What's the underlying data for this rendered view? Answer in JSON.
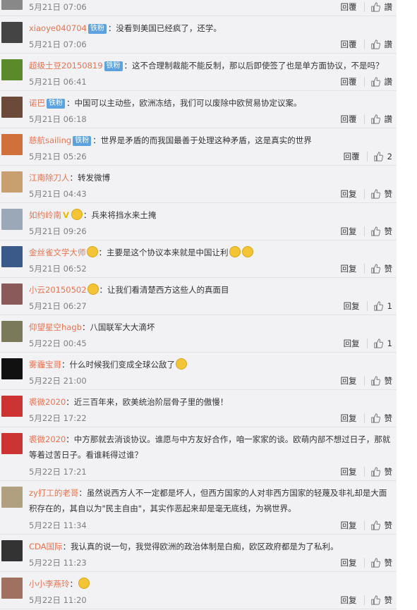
{
  "labels": {
    "reply": "回復",
    "like": "赞"
  },
  "comments": [
    {
      "id": "c0",
      "user": "",
      "badge": "",
      "text": "",
      "date": "5月21日 07:06",
      "reply": "回覆",
      "like": "讚",
      "avatar": "#888888"
    },
    {
      "id": "c1",
      "user": "xiaoye040704",
      "badge": "铁粉",
      "text": "：没看到美国已经疯了，还学。",
      "date": "5月21日 07:06",
      "reply": "回覆",
      "like": "讚",
      "avatar": "#444444"
    },
    {
      "id": "c2",
      "user": "超级土豆20150819",
      "badge": "铁粉",
      "text": "：这不合理制裁能不能反制，那以后即使签了也是单方面协议，不是吗？",
      "date": "5月21日 06:41",
      "reply": "回覆",
      "like": "讚",
      "avatar": "#5a8a2a"
    },
    {
      "id": "c3",
      "user": "诺巴",
      "badge": "铁粉",
      "text": "：中国可以主动些，欧洲冻结，我们可以废除中欧贸易协定议案。",
      "date": "5月21日 06:18",
      "reply": "回覆",
      "like": "讚",
      "avatar": "#6b4a3a"
    },
    {
      "id": "c4",
      "user": "慈航sailing",
      "badge": "铁粉",
      "text": "：世界是矛盾的而我国最善于处理这种矛盾，这是真实的世界",
      "date": "5月21日 05:26",
      "reply": "回覆",
      "like": "2",
      "avatar": "#d0703a"
    },
    {
      "id": "c5",
      "user": "江南除刀人",
      "badge": "",
      "text": "：转发微博",
      "date": "5月21日 04:43",
      "reply": "回复",
      "like": "赞",
      "avatar": "#c8a070"
    },
    {
      "id": "c6",
      "user": "如约岭南",
      "badge": "",
      "vip": "V",
      "emoji": true,
      "text": "：兵来将挡水来土掩",
      "date": "5月21日 09:26",
      "reply": "回复",
      "like": "赞",
      "avatar": "#9aa8b8"
    },
    {
      "id": "c7",
      "user": "金丝雀文学大师",
      "badge": "",
      "emoji": true,
      "text": "：主要是这个协议本来就是中国让利",
      "tailEmoji": 2,
      "date": "5月21日 06:52",
      "reply": "回复",
      "like": "赞",
      "avatar": "#3a5a8a"
    },
    {
      "id": "c8",
      "user": "小云20150502",
      "badge": "",
      "emoji": true,
      "text": "：让我们看清楚西方这些人的真面目",
      "date": "5月21日 06:27",
      "reply": "回复",
      "like": "1",
      "avatar": "#8a5a5a"
    },
    {
      "id": "c9",
      "user": "仰望星空hagb",
      "badge": "",
      "text": "：八国联军大大滴坏",
      "date": "5月22日 00:45",
      "reply": "回复",
      "like": "1",
      "avatar": "#7a7a5a"
    },
    {
      "id": "c10",
      "user": "雾霾宝哥",
      "badge": "",
      "text": "：什么时候我们变成全球公敌了",
      "tailEmoji": 1,
      "date": "5月22日 21:00",
      "reply": "回复",
      "like": "赞",
      "avatar": "#111111"
    },
    {
      "id": "c11",
      "user": "裘微2020",
      "badge": "",
      "text": "：近三百年来，欧美统治阶层骨子里的傲慢！",
      "date": "5月22日 17:22",
      "reply": "回复",
      "like": "赞",
      "avatar": "#cc3333"
    },
    {
      "id": "c12",
      "user": "裘微2020",
      "badge": "",
      "text": "：中方那就去消谈协议。谁愿与中方友好合作，咱一家家的谈。欧萌内部不想过日子，那就等着过苦日子。看谁耗得过谁？",
      "date": "5月22日 17:21",
      "reply": "回复",
      "like": "赞",
      "avatar": "#cc3333",
      "tall": true
    },
    {
      "id": "c13",
      "user": "zy打工的老哥",
      "badge": "",
      "text": "：虽然说西方人不一定都是坏人，但西方国家的人对非西方国家的轻蔑及非礼却是大面积存在的，其自以为\"民主自由\"，其实作恶起来却是毫无底线，为祸世界。",
      "date": "5月22日 11:34",
      "reply": "回复",
      "like": "赞",
      "avatar": "#b0a080",
      "tall": true
    },
    {
      "id": "c14",
      "user": "CDA国际",
      "badge": "",
      "text": "：我认真的说一句，我觉得欧洲的政治体制是白痴，欧区政府都是为了私利。",
      "date": "5月22日 11:23",
      "reply": "回复",
      "like": "赞",
      "avatar": "#333333"
    },
    {
      "id": "c15",
      "user": "小小李燕玲",
      "badge": "",
      "text": "：",
      "tailEmoji": 1,
      "date": "5月22日 11:20",
      "reply": "回复",
      "like": "赞",
      "avatar": "#a07060"
    }
  ]
}
